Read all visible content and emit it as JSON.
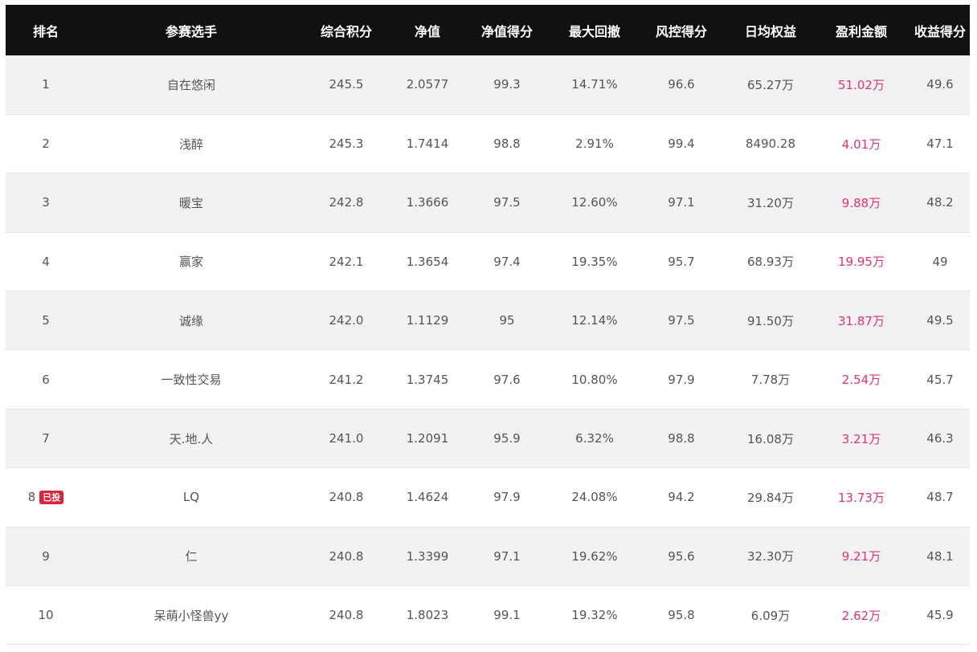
{
  "columns": [
    "排名",
    "参赛选手",
    "综合积分",
    "净值",
    "净值得分",
    "最大回撤",
    "风控得分",
    "日均权益",
    "盈利金额",
    "收益得分"
  ],
  "rows": [
    {
      "rank": "1",
      "badge": "",
      "player": "自在悠闲",
      "score": "245.5",
      "nav": "2.0577",
      "nav_score": "99.3",
      "max_drawdown": "14.71%",
      "risk_score": "96.6",
      "avg_equity": "65.27万",
      "profit": "51.02万",
      "return_score": "49.6"
    },
    {
      "rank": "2",
      "badge": "",
      "player": "浅醉",
      "score": "245.3",
      "nav": "1.7414",
      "nav_score": "98.8",
      "max_drawdown": "2.91%",
      "risk_score": "99.4",
      "avg_equity": "8490.28",
      "profit": "4.01万",
      "return_score": "47.1"
    },
    {
      "rank": "3",
      "badge": "",
      "player": "暖宝",
      "score": "242.8",
      "nav": "1.3666",
      "nav_score": "97.5",
      "max_drawdown": "12.60%",
      "risk_score": "97.1",
      "avg_equity": "31.20万",
      "profit": "9.88万",
      "return_score": "48.2"
    },
    {
      "rank": "4",
      "badge": "",
      "player": "赢家",
      "score": "242.1",
      "nav": "1.3654",
      "nav_score": "97.4",
      "max_drawdown": "19.35%",
      "risk_score": "95.7",
      "avg_equity": "68.93万",
      "profit": "19.95万",
      "return_score": "49"
    },
    {
      "rank": "5",
      "badge": "",
      "player": "诚缘",
      "score": "242.0",
      "nav": "1.1129",
      "nav_score": "95",
      "max_drawdown": "12.14%",
      "risk_score": "97.5",
      "avg_equity": "91.50万",
      "profit": "31.87万",
      "return_score": "49.5"
    },
    {
      "rank": "6",
      "badge": "",
      "player": "一致性交易",
      "score": "241.2",
      "nav": "1.3745",
      "nav_score": "97.6",
      "max_drawdown": "10.80%",
      "risk_score": "97.9",
      "avg_equity": "7.78万",
      "profit": "2.54万",
      "return_score": "45.7"
    },
    {
      "rank": "7",
      "badge": "",
      "player": "天.地.人",
      "score": "241.0",
      "nav": "1.2091",
      "nav_score": "95.9",
      "max_drawdown": "6.32%",
      "risk_score": "98.8",
      "avg_equity": "16.08万",
      "profit": "3.21万",
      "return_score": "46.3"
    },
    {
      "rank": "8",
      "badge": "已投",
      "player": "LQ",
      "score": "240.8",
      "nav": "1.4624",
      "nav_score": "97.9",
      "max_drawdown": "24.08%",
      "risk_score": "94.2",
      "avg_equity": "29.84万",
      "profit": "13.73万",
      "return_score": "48.7"
    },
    {
      "rank": "9",
      "badge": "",
      "player": "仁",
      "score": "240.8",
      "nav": "1.3399",
      "nav_score": "97.1",
      "max_drawdown": "19.62%",
      "risk_score": "95.6",
      "avg_equity": "32.30万",
      "profit": "9.21万",
      "return_score": "48.1"
    },
    {
      "rank": "10",
      "badge": "",
      "player": "呆萌小怪兽yy",
      "score": "240.8",
      "nav": "1.8023",
      "nav_score": "99.1",
      "max_drawdown": "19.32%",
      "risk_score": "95.8",
      "avg_equity": "6.09万",
      "profit": "2.62万",
      "return_score": "45.9"
    }
  ],
  "colors": {
    "header_bg": "#111111",
    "profit": "#e5336a",
    "badge": "#e0233a",
    "row_alt": "#f2f2f2"
  }
}
